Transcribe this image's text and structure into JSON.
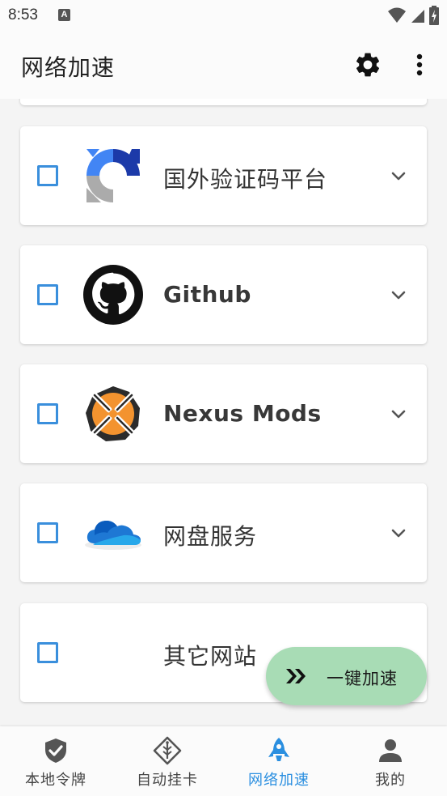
{
  "status_bar": {
    "time": "8:53",
    "notification_icon": "A"
  },
  "app_bar": {
    "title": "网络加速",
    "settings_icon": "gear-icon",
    "more_icon": "more-vert-icon"
  },
  "items": [
    {
      "title": "国外验证码平台",
      "logo": "recaptcha-logo",
      "checked": false,
      "has_chevron": true
    },
    {
      "title": "Github",
      "logo": "github-logo",
      "checked": false,
      "has_chevron": true
    },
    {
      "title": "Nexus Mods",
      "logo": "nexus-mods-logo",
      "checked": false,
      "has_chevron": true
    },
    {
      "title": "网盘服务",
      "logo": "onedrive-logo",
      "checked": false,
      "has_chevron": true
    },
    {
      "title": "其它网站",
      "logo": "",
      "checked": false,
      "has_chevron": false
    }
  ],
  "fab": {
    "label": "一键加速",
    "icon": "double-chevron-right-icon"
  },
  "bottom_nav": [
    {
      "label": "本地令牌",
      "icon": "shield-check-icon",
      "active": false
    },
    {
      "label": "自动挂卡",
      "icon": "diamond-tag-icon",
      "active": false
    },
    {
      "label": "网络加速",
      "icon": "rocket-icon",
      "active": true
    },
    {
      "label": "我的",
      "icon": "person-icon",
      "active": false
    }
  ],
  "colors": {
    "accent": "#2b8fe0",
    "checkbox": "#3a8fdc",
    "fab_bg": "#a8dcb5",
    "background": "#f4f4f4"
  }
}
